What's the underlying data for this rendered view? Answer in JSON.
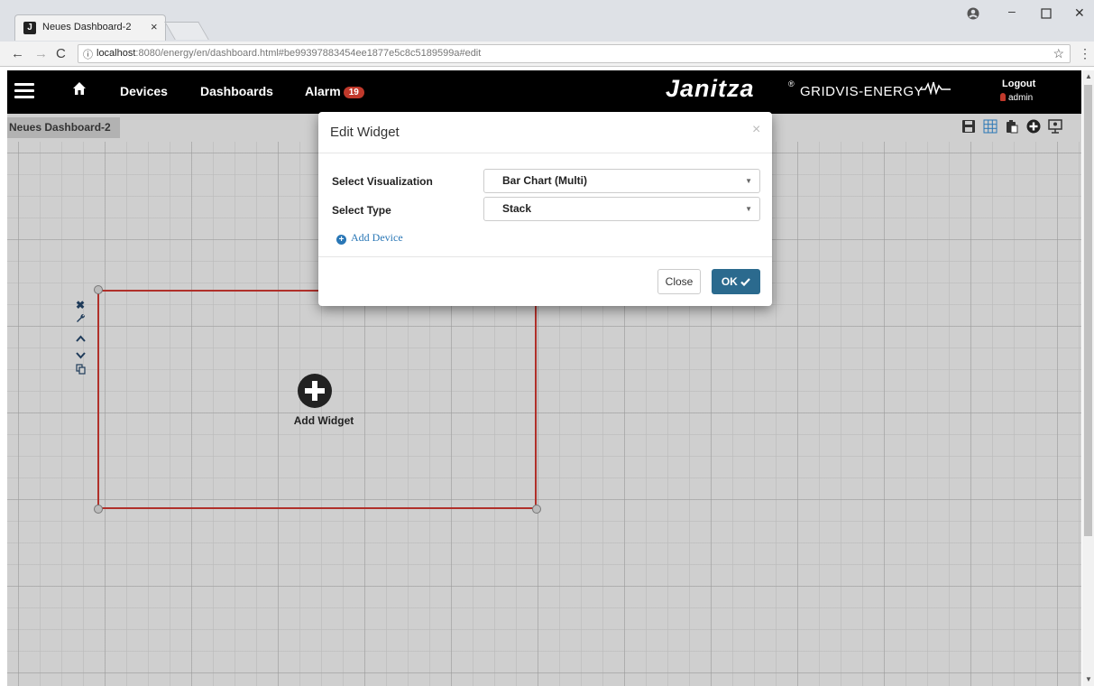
{
  "browser": {
    "tab_title": "Neues Dashboard-2",
    "tab_close": "×",
    "favicon": "J",
    "url_host": "localhost",
    "url_rest": ":8080/energy/en/dashboard.html#be99397883454ee1877e5c8c5189599a#edit",
    "icons": [
      "back-arrow-icon",
      "forward-arrow-icon",
      "reload-icon",
      "info-icon",
      "star-icon",
      "menu-kebab-icon",
      "account-icon"
    ]
  },
  "navbar": {
    "devices_label": "Devices",
    "dashboards_label": "Dashboards",
    "alarm_label": "Alarm",
    "alarm_count": "19",
    "brand_name": "Janitza",
    "brand_reg": "®",
    "brand_product": "GRIDVIS-ENERGY",
    "logout_label": "Logout",
    "user_name": "admin"
  },
  "dashboard": {
    "tab_label": "Neues Dashboard-2",
    "toolbar_icons": [
      "save-icon",
      "grid-icon",
      "clipboard-icon",
      "add-circle-icon",
      "presentation-icon"
    ]
  },
  "widget": {
    "add_label": "Add Widget"
  },
  "modal": {
    "title": "Edit Widget",
    "close_x": "×",
    "visualization_label": "Select Visualization",
    "visualization_value": "Bar Chart (Multi)",
    "type_label": "Select Type",
    "type_value": "Stack",
    "add_device_label": "Add Device",
    "close_button": "Close",
    "ok_button": "OK"
  },
  "colors": {
    "navbar_bg": "#000000",
    "canvas_bg": "#cfcfcf",
    "widget_border": "#b0302a",
    "alarm_badge": "#c0392b",
    "ok_button_bg": "#2b6a8e",
    "link_blue": "#2a77b6"
  }
}
